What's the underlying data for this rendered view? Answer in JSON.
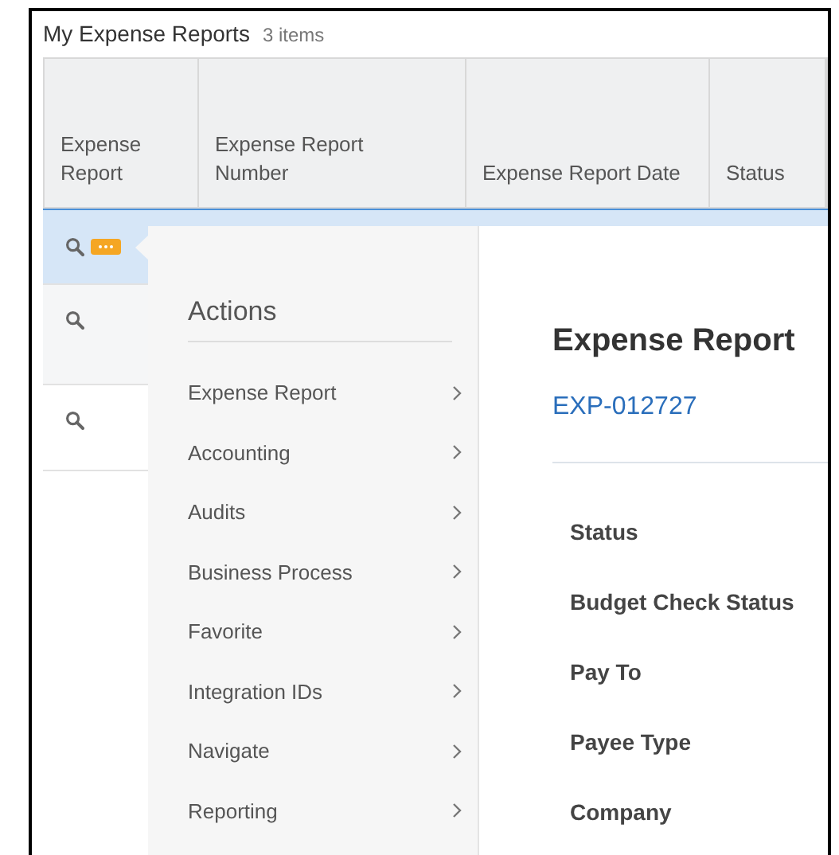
{
  "list": {
    "title": "My Expense Reports",
    "count": "3 items"
  },
  "table": {
    "columns": [
      "Expense Report",
      "Expense Report Number",
      "Expense Report Date",
      "Status"
    ],
    "rows": [
      {
        "selected": true,
        "actions_button": true
      },
      {
        "selected": false,
        "actions_button": false
      },
      {
        "selected": false,
        "actions_button": false
      }
    ]
  },
  "actions_menu": {
    "title": "Actions",
    "items": [
      "Expense Report",
      "Accounting",
      "Audits",
      "Business Process",
      "Favorite",
      "Integration IDs",
      "Navigate",
      "Reporting"
    ]
  },
  "detail": {
    "title": "Expense Report",
    "link": "EXP-012727",
    "fields": [
      "Status",
      "Budget Check Status",
      "Pay To",
      "Payee Type",
      "Company"
    ]
  }
}
